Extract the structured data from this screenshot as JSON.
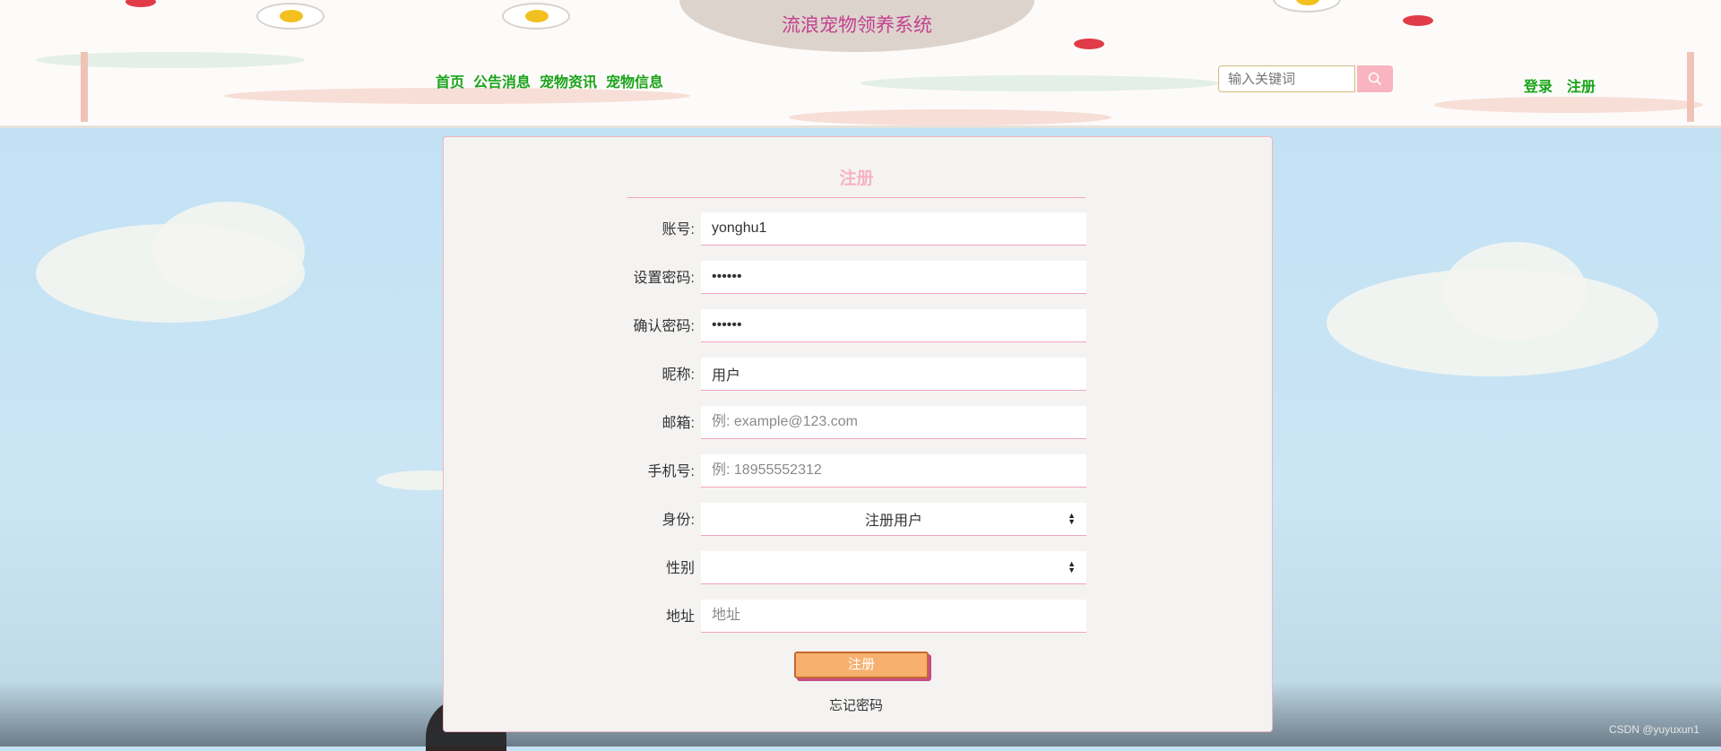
{
  "header": {
    "site_title": "流浪宠物领养系统",
    "nav": [
      "首页",
      "公告消息",
      "宠物资讯",
      "宠物信息"
    ],
    "search": {
      "placeholder": "输入关键词"
    },
    "login": "登录",
    "register": "注册"
  },
  "form": {
    "title": "注册",
    "fields": [
      {
        "label": "账号:",
        "value": "yonghu1",
        "placeholder": ""
      },
      {
        "label": "设置密码:",
        "value": "••••••",
        "placeholder": ""
      },
      {
        "label": "确认密码:",
        "value": "••••••",
        "placeholder": ""
      },
      {
        "label": "昵称:",
        "value": "用户",
        "placeholder": ""
      },
      {
        "label": "邮箱:",
        "value": "",
        "placeholder": "例: example@123.com"
      },
      {
        "label": "手机号:",
        "value": "",
        "placeholder": "例: 18955552312"
      }
    ],
    "role": {
      "label": "身份:",
      "value": "注册用户"
    },
    "gender": {
      "label": "性别",
      "value": ""
    },
    "address": {
      "label": "地址",
      "placeholder": "地址"
    },
    "submit": "注册",
    "forgot": "忘记密码"
  },
  "watermark": "CSDN @yuyuxun1",
  "colors": {
    "nav_green": "#1aa31a",
    "title_magenta": "#c2418e",
    "accent_pink": "#f7b3c3",
    "submit_orange": "#f7b06e",
    "sky_blue": "#c5e2f3"
  }
}
